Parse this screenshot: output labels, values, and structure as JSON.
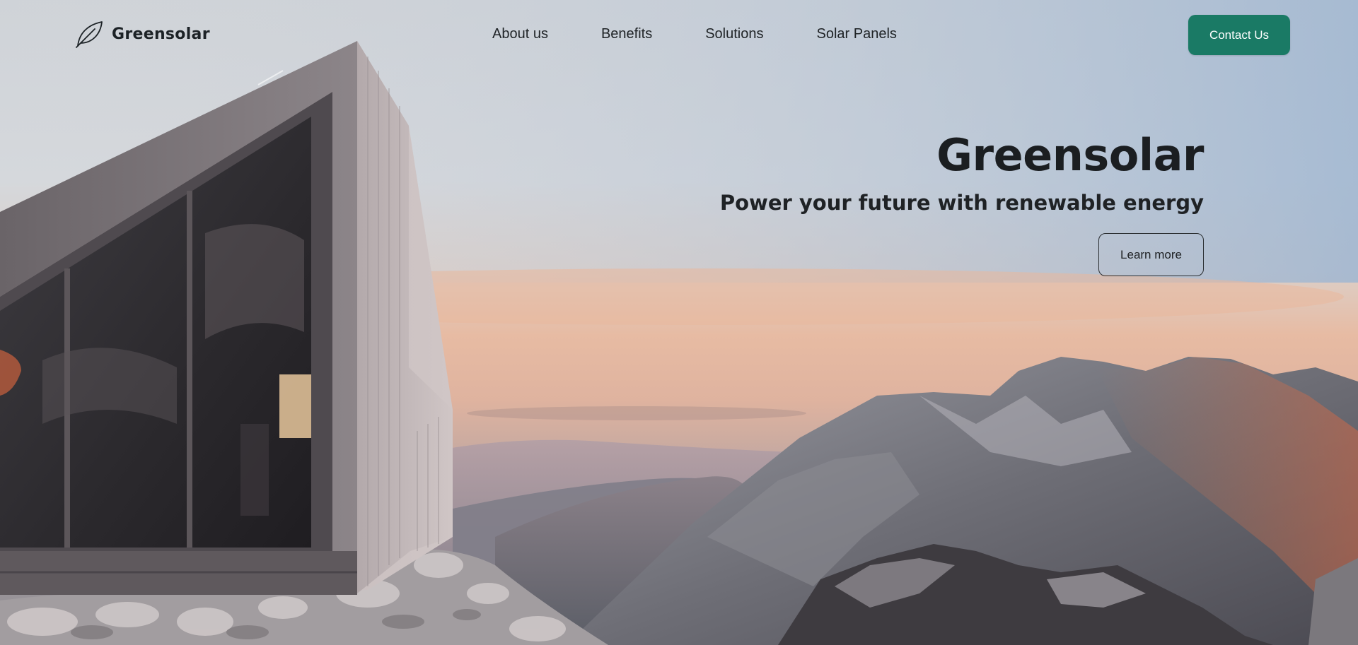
{
  "brand": {
    "name": "Greensolar",
    "icon": "leaf-icon"
  },
  "nav": {
    "links": [
      "About us",
      "Benefits",
      "Solutions",
      "Solar Panels"
    ],
    "cta": "Contact Us"
  },
  "hero": {
    "title": "Greensolar",
    "subtitle": "Power your future with renewable energy",
    "button": "Learn more",
    "image": "mountain-cabin-at-sunset"
  },
  "colors": {
    "accent": "#1a7a65",
    "text_dark": "#1b1e21",
    "sky_top": "#a3b8cf",
    "sky_glow": "#e2b49e"
  }
}
